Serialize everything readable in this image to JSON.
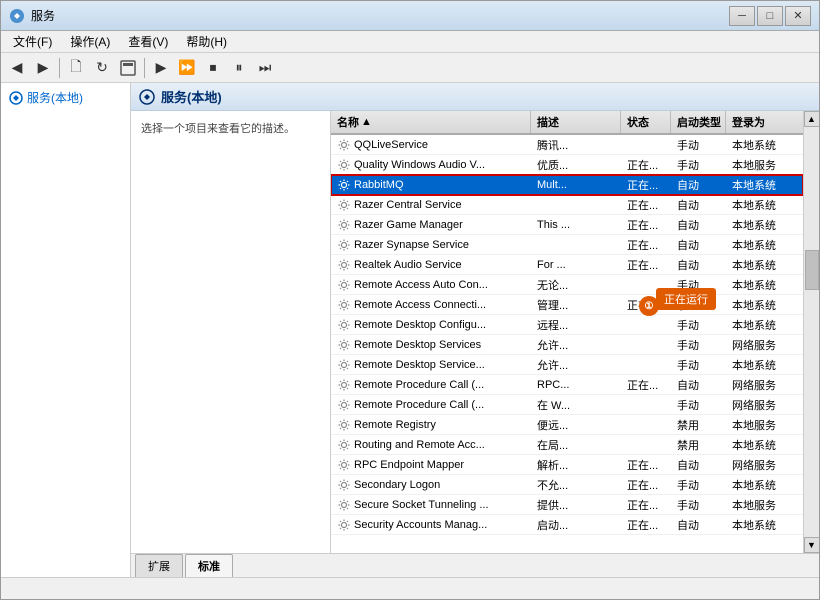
{
  "window": {
    "title": "服务",
    "titleButtons": {
      "minimize": "─",
      "maximize": "□",
      "close": "✕"
    }
  },
  "menuBar": {
    "items": [
      {
        "label": "文件(F)"
      },
      {
        "label": "操作(A)"
      },
      {
        "label": "查看(V)"
      },
      {
        "label": "帮助(H)"
      }
    ]
  },
  "toolbar": {
    "buttons": [
      "←",
      "→",
      "🗋",
      "↺",
      "▶",
      "▶▶",
      "⏹",
      "⏸",
      "⏭"
    ]
  },
  "sidebar": {
    "title": "服务(本地)",
    "hint": "选择一个项目来查看它的描述。"
  },
  "contentHeader": {
    "title": "服务(本地)"
  },
  "listHeaders": [
    {
      "label": "名称",
      "col": "col-name"
    },
    {
      "label": "描述",
      "col": "col-desc"
    },
    {
      "label": "状态",
      "col": "col-status"
    },
    {
      "label": "启动类型",
      "col": "col-startup"
    },
    {
      "label": "登录为",
      "col": "col-login"
    }
  ],
  "services": [
    {
      "name": "QQLiveService",
      "desc": "腾讯...",
      "status": "",
      "startup": "手动",
      "login": "本地系统"
    },
    {
      "name": "Quality Windows Audio V...",
      "desc": "优质...",
      "status": "正在...",
      "startup": "手动",
      "login": "本地服务"
    },
    {
      "name": "RabbitMQ",
      "desc": "Mult...",
      "status": "正在...",
      "startup": "自动",
      "login": "本地系统",
      "selected": true
    },
    {
      "name": "Razer Central Service",
      "desc": "",
      "status": "正在...",
      "startup": "自动",
      "login": "本地系统"
    },
    {
      "name": "Razer Game Manager",
      "desc": "This ...",
      "status": "正在...",
      "startup": "自动",
      "login": "本地系统"
    },
    {
      "name": "Razer Synapse Service",
      "desc": "",
      "status": "正在...",
      "startup": "自动",
      "login": "本地系统"
    },
    {
      "name": "Realtek Audio Service",
      "desc": "For ...",
      "status": "正在...",
      "startup": "自动",
      "login": "本地系统"
    },
    {
      "name": "Remote Access Auto Con...",
      "desc": "无论...",
      "status": "",
      "startup": "手动",
      "login": "本地系统"
    },
    {
      "name": "Remote Access Connecti...",
      "desc": "管理...",
      "status": "正在...",
      "startup": "手动",
      "login": "本地系统"
    },
    {
      "name": "Remote Desktop Configu...",
      "desc": "远程...",
      "status": "",
      "startup": "手动",
      "login": "本地系统"
    },
    {
      "name": "Remote Desktop Services",
      "desc": "允许...",
      "status": "",
      "startup": "手动",
      "login": "网络服务"
    },
    {
      "name": "Remote Desktop Service...",
      "desc": "允许...",
      "status": "",
      "startup": "手动",
      "login": "本地系统"
    },
    {
      "name": "Remote Procedure Call (...",
      "desc": "RPC...",
      "status": "正在...",
      "startup": "自动",
      "login": "网络服务"
    },
    {
      "name": "Remote Procedure Call (...",
      "desc": "在 W...",
      "status": "",
      "startup": "手动",
      "login": "网络服务"
    },
    {
      "name": "Remote Registry",
      "desc": "便远...",
      "status": "",
      "startup": "禁用",
      "login": "本地服务"
    },
    {
      "name": "Routing and Remote Acc...",
      "desc": "在局...",
      "status": "",
      "startup": "禁用",
      "login": "本地系统"
    },
    {
      "name": "RPC Endpoint Mapper",
      "desc": "解析...",
      "status": "正在...",
      "startup": "自动",
      "login": "网络服务"
    },
    {
      "name": "Secondary Logon",
      "desc": "不允...",
      "status": "正在...",
      "startup": "手动",
      "login": "本地系统"
    },
    {
      "name": "Secure Socket Tunneling ...",
      "desc": "提供...",
      "status": "正在...",
      "startup": "手动",
      "login": "本地服务"
    },
    {
      "name": "Security Accounts Manag...",
      "desc": "启动...",
      "status": "正在...",
      "startup": "自动",
      "login": "本地系统"
    }
  ],
  "tooltip": {
    "badge": "①",
    "text": "正在运行"
  },
  "tabs": [
    {
      "label": "扩展",
      "active": false
    },
    {
      "label": "标准",
      "active": true
    }
  ]
}
